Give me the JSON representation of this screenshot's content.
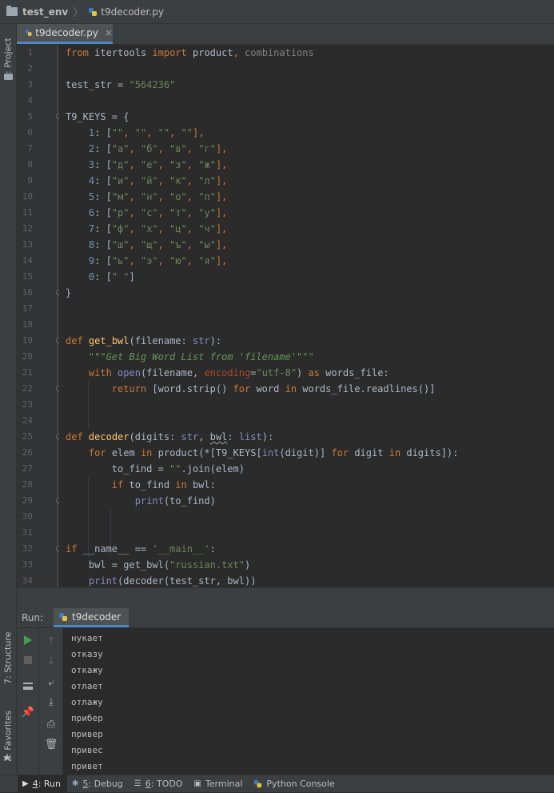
{
  "breadcrumb": {
    "project": "test_env",
    "file": "t9decoder.py"
  },
  "left_strip": {
    "project_tab": "1: Project",
    "structure_tab": "7: Structure",
    "favorites_tab": "2: Favorites"
  },
  "editor_tab": {
    "label": "t9decoder.py",
    "close": "×"
  },
  "line_numbers": [
    "1",
    "2",
    "3",
    "4",
    "5",
    "6",
    "7",
    "8",
    "9",
    "10",
    "11",
    "12",
    "13",
    "14",
    "15",
    "16",
    "17",
    "18",
    "19",
    "20",
    "21",
    "22",
    "23",
    "24",
    "25",
    "26",
    "27",
    "28",
    "29",
    "30",
    "31",
    "32",
    "33",
    "34"
  ],
  "code": {
    "l1": [
      "from",
      "itertools",
      "import",
      "product",
      ", ",
      "combinations"
    ],
    "l3": [
      "test_str = ",
      "\"564236\""
    ],
    "l5": [
      "T9_KEYS = {"
    ],
    "l6": [
      "    ",
      "1",
      ": [",
      "\"\"",
      ", ",
      "\"\"",
      ", ",
      "\"\"",
      ", ",
      "\"\"",
      "],"
    ],
    "l7": [
      "    ",
      "2",
      ": [",
      "\"а\"",
      ", ",
      "\"б\"",
      ", ",
      "\"в\"",
      ", ",
      "\"г\"",
      "],"
    ],
    "l8": [
      "    ",
      "3",
      ": [",
      "\"д\"",
      ", ",
      "\"е\"",
      ", ",
      "\"з\"",
      ", ",
      "\"ж\"",
      "],"
    ],
    "l9": [
      "    ",
      "4",
      ": [",
      "\"и\"",
      ", ",
      "\"й\"",
      ", ",
      "\"к\"",
      ", ",
      "\"л\"",
      "],"
    ],
    "l10": [
      "    ",
      "5",
      ": [",
      "\"м\"",
      ", ",
      "\"н\"",
      ", ",
      "\"о\"",
      ", ",
      "\"п\"",
      "],"
    ],
    "l11": [
      "    ",
      "6",
      ": [",
      "\"р\"",
      ", ",
      "\"с\"",
      ", ",
      "\"т\"",
      ", ",
      "\"у\"",
      "],"
    ],
    "l12": [
      "    ",
      "7",
      ": [",
      "\"ф\"",
      ", ",
      "\"х\"",
      ", ",
      "\"ц\"",
      ", ",
      "\"ч\"",
      "],"
    ],
    "l13": [
      "    ",
      "8",
      ": [",
      "\"ш\"",
      ", ",
      "\"щ\"",
      ", ",
      "\"ъ\"",
      ", ",
      "\"ы\"",
      "],"
    ],
    "l14": [
      "    ",
      "9",
      ": [",
      "\"ь\"",
      ", ",
      "\"э\"",
      ", ",
      "\"ю\"",
      ", ",
      "\"я\"",
      "],"
    ],
    "l15": [
      "    ",
      "0",
      ": [",
      "\" \"",
      "]"
    ],
    "l16": [
      "}"
    ],
    "l19": [
      "def",
      "get_bwl",
      "(filename: ",
      "str",
      "):"
    ],
    "l20": [
      "    ",
      "\"\"\"Get Big Word List from 'filename'\"\"\""
    ],
    "l21": [
      "    ",
      "with",
      " ",
      "open",
      "(filename, ",
      "encoding",
      "=",
      "\"utf-8\"",
      ") ",
      "as",
      " words_file:"
    ],
    "l22": [
      "        ",
      "return",
      " [word.strip() ",
      "for",
      " word ",
      "in",
      " words_file.readlines()]"
    ],
    "l25": [
      "def",
      "decoder",
      "(digits: ",
      "str",
      ", ",
      "bwl",
      ": ",
      "list",
      "):"
    ],
    "l26": [
      "    ",
      "for",
      " elem ",
      "in",
      " product(*[T9_KEYS[",
      "int",
      "(digit)] ",
      "for",
      " digit ",
      "in",
      " digits]):"
    ],
    "l27": [
      "        ",
      "to_find = ",
      "\"\"",
      ".join(elem)"
    ],
    "l28": [
      "        ",
      "if",
      " to_find ",
      "in",
      " bwl:"
    ],
    "l29": [
      "            ",
      "print",
      "(to_find)"
    ],
    "l32": [
      "if",
      " __name__ == ",
      "'__main__'",
      ":"
    ],
    "l33": [
      "    ",
      "bwl = get_bwl(",
      "\"russian.txt\"",
      ")"
    ],
    "l34": [
      "    ",
      "print",
      "(decoder(test_str, bwl))"
    ]
  },
  "run": {
    "label": "Run:",
    "tab": "t9decoder",
    "output": [
      "нукает",
      "отказу",
      "откажу",
      "отлает",
      "отлажу",
      "прибер",
      "привер",
      "привес",
      "привет"
    ]
  },
  "bottom_bar": {
    "run": {
      "num": "4",
      "label": ": Run"
    },
    "debug": {
      "num": "5",
      "label": ": Debug"
    },
    "todo": {
      "num": "6",
      "label": ": TODO"
    },
    "terminal": "Terminal",
    "python_console": "Python Console"
  },
  "colors": {
    "background": "#2b2b2b",
    "keyword": "#cc7832",
    "string": "#6a8759",
    "number": "#6897bb",
    "function": "#ffc66d",
    "builtin": "#8888c6",
    "accent": "#4a88c7",
    "run_green": "#499c54"
  }
}
